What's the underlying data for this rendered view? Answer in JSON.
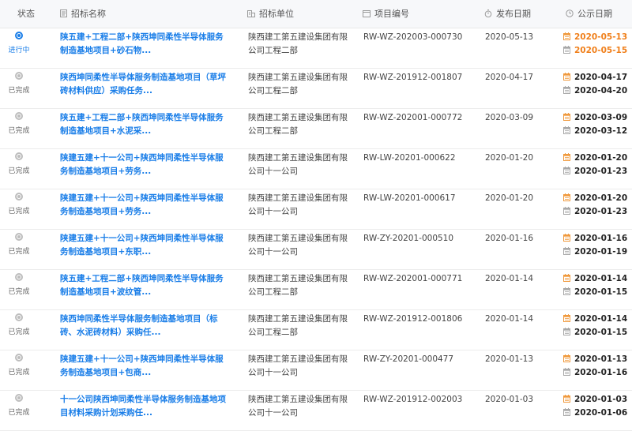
{
  "header": {
    "status": "状态",
    "title": "招标名称",
    "unit": "招标单位",
    "code": "项目编号",
    "pubdate": "发布日期",
    "period": "公示日期"
  },
  "colors": {
    "accent": "#1a7ee8",
    "highlight": "#f07f1a"
  },
  "rows": [
    {
      "status": "进行中",
      "active": true,
      "title": "陕五建+工程二部+陕西坤同柔性半导体服务制造基地项目+砂石物...",
      "unit": "陕西建工第五建设集团有限公司工程二部",
      "code": "RW-WZ-202003-000730",
      "pubdate": "2020-05-13",
      "start": "2020-05-13",
      "end": "2020-05-15"
    },
    {
      "status": "已完成",
      "active": false,
      "title": "陕西坤同柔性半导体服务制造基地项目（草坪砖材料供应）采购任务...",
      "unit": "陕西建工第五建设集团有限公司工程二部",
      "code": "RW-WZ-201912-001807",
      "pubdate": "2020-04-17",
      "start": "2020-04-17",
      "end": "2020-04-20"
    },
    {
      "status": "已完成",
      "active": false,
      "title": "陕五建+工程二部+陕西坤同柔性半导体服务制造基地项目+水泥采...",
      "unit": "陕西建工第五建设集团有限公司工程二部",
      "code": "RW-WZ-202001-000772",
      "pubdate": "2020-03-09",
      "start": "2020-03-09",
      "end": "2020-03-12"
    },
    {
      "status": "已完成",
      "active": false,
      "title": "陕建五建+十一公司+陕西坤同柔性半导体服务制造基地项目+劳务...",
      "unit": "陕西建工第五建设集团有限公司十一公司",
      "code": "RW-LW-20201-000622",
      "pubdate": "2020-01-20",
      "start": "2020-01-20",
      "end": "2020-01-23"
    },
    {
      "status": "已完成",
      "active": false,
      "title": "陕建五建+十一公司+陕西坤同柔性半导体服务制造基地项目+劳务...",
      "unit": "陕西建工第五建设集团有限公司十一公司",
      "code": "RW-LW-20201-000617",
      "pubdate": "2020-01-20",
      "start": "2020-01-20",
      "end": "2020-01-23"
    },
    {
      "status": "已完成",
      "active": false,
      "title": "陕建五建+十一公司+陕西坤同柔性半导体服务制造基地项目+东职...",
      "unit": "陕西建工第五建设集团有限公司十一公司",
      "code": "RW-ZY-20201-000510",
      "pubdate": "2020-01-16",
      "start": "2020-01-16",
      "end": "2020-01-19"
    },
    {
      "status": "已完成",
      "active": false,
      "title": "陕五建+工程二部+陕西坤同柔性半导体服务制造基地项目+波纹管...",
      "unit": "陕西建工第五建设集团有限公司工程二部",
      "code": "RW-WZ-202001-000771",
      "pubdate": "2020-01-14",
      "start": "2020-01-14",
      "end": "2020-01-15"
    },
    {
      "status": "已完成",
      "active": false,
      "title": "陕西坤同柔性半导体服务制造基地项目（标砖、水泥砖材料）采购任...",
      "unit": "陕西建工第五建设集团有限公司工程二部",
      "code": "RW-WZ-201912-001806",
      "pubdate": "2020-01-14",
      "start": "2020-01-14",
      "end": "2020-01-15"
    },
    {
      "status": "已完成",
      "active": false,
      "title": "陕建五建+十一公司+陕西坤同柔性半导体服务制造基地项目+包商...",
      "unit": "陕西建工第五建设集团有限公司十一公司",
      "code": "RW-ZY-20201-000477",
      "pubdate": "2020-01-13",
      "start": "2020-01-13",
      "end": "2020-01-16"
    },
    {
      "status": "已完成",
      "active": false,
      "title": "十一公司陕西坤同柔性半导体服务制造基地项目材料采购计划采购任...",
      "unit": "陕西建工第五建设集团有限公司十一公司",
      "code": "RW-WZ-201912-002003",
      "pubdate": "2020-01-03",
      "start": "2020-01-03",
      "end": "2020-01-06"
    }
  ]
}
